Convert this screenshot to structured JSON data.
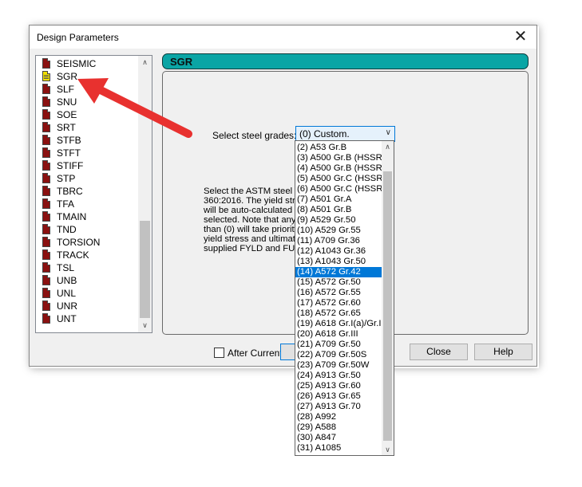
{
  "window": {
    "title": "Design Parameters",
    "close_glyph": "✕"
  },
  "parameter_list": {
    "items": [
      {
        "label": "SEISMIC",
        "selected": false
      },
      {
        "label": "SGR",
        "selected": true
      },
      {
        "label": "SLF",
        "selected": false
      },
      {
        "label": "SNU",
        "selected": false
      },
      {
        "label": "SOE",
        "selected": false
      },
      {
        "label": "SRT",
        "selected": false
      },
      {
        "label": "STFB",
        "selected": false
      },
      {
        "label": "STFT",
        "selected": false
      },
      {
        "label": "STIFF",
        "selected": false
      },
      {
        "label": "STP",
        "selected": false
      },
      {
        "label": "TBRC",
        "selected": false
      },
      {
        "label": "TFA",
        "selected": false
      },
      {
        "label": "TMAIN",
        "selected": false
      },
      {
        "label": "TND",
        "selected": false
      },
      {
        "label": "TORSION",
        "selected": false
      },
      {
        "label": "TRACK",
        "selected": false
      },
      {
        "label": "TSL",
        "selected": false
      },
      {
        "label": "UNB",
        "selected": false
      },
      {
        "label": "UNL",
        "selected": false
      },
      {
        "label": "UNR",
        "selected": false
      },
      {
        "label": "UNT",
        "selected": false
      }
    ],
    "scroll_up_glyph": "∧",
    "scroll_down_glyph": "∨"
  },
  "section_header": "SGR",
  "steel_grade": {
    "label": "Select steel grades:",
    "selected_value": "(0) Custom.",
    "chevron_glyph": "∨",
    "options": [
      "(2) A53 Gr.B",
      "(3) A500 Gr.B (HSSRe",
      "(4) A500 Gr.B (HSSRo",
      "(5) A500 Gr.C (HSSRe",
      "(6) A500 Gr.C (HSSRo",
      "(7) A501 Gr.A",
      "(8) A501 Gr.B",
      "(9) A529 Gr.50",
      "(10) A529 Gr.55",
      "(11) A709 Gr.36",
      "(12) A1043 Gr.36",
      "(13) A1043 Gr.50",
      "(14) A572 Gr.42",
      "(15) A572 Gr.50",
      "(16) A572 Gr.55",
      "(17) A572 Gr.60",
      "(18) A572 Gr.65",
      "(19) A618 Gr.I(a)/Gr.I(",
      "(20) A618 Gr.III",
      "(21) A709 Gr.50",
      "(22) A709 Gr.50S",
      "(23) A709 Gr.50W",
      "(24) A913 Gr.50",
      "(25) A913 Gr.60",
      "(26) A913 Gr.65",
      "(27) A913 Gr.70",
      "(28) A992",
      "(29) A588",
      "(30) A847",
      "(31) A1085"
    ],
    "highlighted_option": "(14) A572 Gr.42"
  },
  "description_lines": [
    "Select the ASTM steel g",
    "360:2016. The yield stre",
    "will be auto-calculated b",
    "selected. Note that any",
    "than (0) will take priority",
    "yield stress and ultimate",
    "supplied FYLD and FU v"
  ],
  "footer": {
    "after_current_label": "After Current",
    "after_current_checked": false,
    "close_label": "Close",
    "help_label": "Help"
  },
  "annotation": {
    "arrow_color": "#e8312f"
  }
}
